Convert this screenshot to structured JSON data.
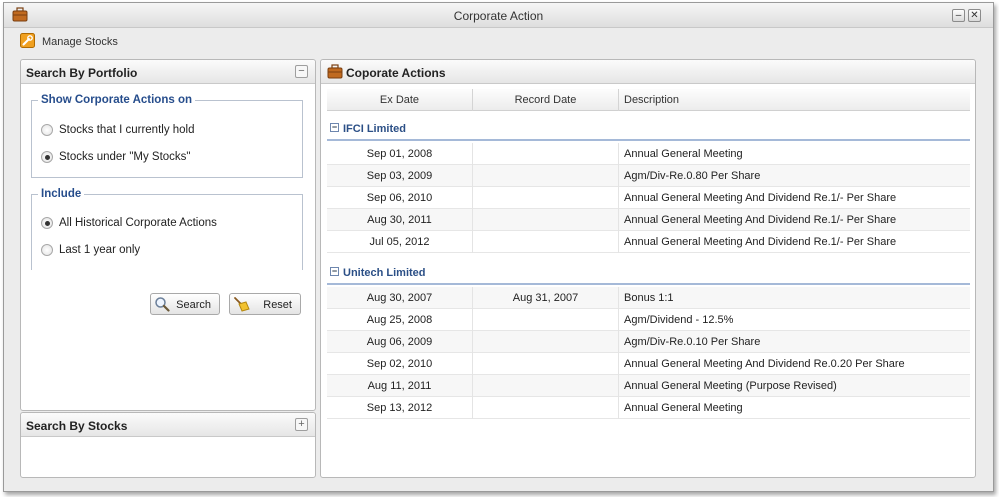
{
  "window": {
    "title": "Corporate Action",
    "minimize_label": "–",
    "close_label": "✕"
  },
  "toolbar": {
    "manage_label": "Manage Stocks"
  },
  "portfolio_panel": {
    "title": "Search By Portfolio",
    "collapse_label": "−",
    "show_group": {
      "legend": "Show Corporate Actions on",
      "options": [
        {
          "label": "Stocks that I currently hold",
          "selected": false
        },
        {
          "label": "Stocks under \"My Stocks\"",
          "selected": true
        }
      ]
    },
    "include_group": {
      "legend": "Include",
      "options": [
        {
          "label": "All Historical Corporate Actions",
          "selected": true
        },
        {
          "label": "Last 1 year only",
          "selected": false
        }
      ]
    },
    "search_button": "Search",
    "reset_button": "Reset"
  },
  "stocks_panel": {
    "title": "Search By Stocks",
    "expand_label": "+"
  },
  "actions_panel": {
    "title": "Coporate Actions",
    "columns": [
      "Ex Date",
      "Record Date",
      "Description"
    ],
    "groups": [
      {
        "name": "IFCI Limited",
        "expand_label": "−",
        "rows": [
          {
            "ex_date": "Sep 01, 2008",
            "record_date": "",
            "description": "Annual General Meeting"
          },
          {
            "ex_date": "Sep 03, 2009",
            "record_date": "",
            "description": "Agm/Div-Re.0.80 Per Share"
          },
          {
            "ex_date": "Sep 06, 2010",
            "record_date": "",
            "description": "Annual General Meeting And Dividend Re.1/- Per Share"
          },
          {
            "ex_date": "Aug 30, 2011",
            "record_date": "",
            "description": "Annual General Meeting And Dividend Re.1/- Per Share"
          },
          {
            "ex_date": "Jul 05, 2012",
            "record_date": "",
            "description": "Annual General Meeting And Dividend Re.1/- Per Share"
          }
        ]
      },
      {
        "name": "Unitech Limited",
        "expand_label": "−",
        "rows": [
          {
            "ex_date": "Aug 30, 2007",
            "record_date": "Aug 31, 2007",
            "description": "Bonus 1:1"
          },
          {
            "ex_date": "Aug 25, 2008",
            "record_date": "",
            "description": "Agm/Dividend - 12.5%"
          },
          {
            "ex_date": "Aug 06, 2009",
            "record_date": "",
            "description": "Agm/Div-Re.0.10 Per Share"
          },
          {
            "ex_date": "Sep 02, 2010",
            "record_date": "",
            "description": "Annual General Meeting And Dividend Re.0.20 Per Share"
          },
          {
            "ex_date": "Aug 11, 2011",
            "record_date": "",
            "description": "Annual General Meeting (Purpose Revised)"
          },
          {
            "ex_date": "Sep 13, 2012",
            "record_date": "",
            "description": "Annual General Meeting"
          }
        ]
      }
    ]
  },
  "colors": {
    "legend_text": "#264d8c",
    "group_text": "#2b4f86",
    "briefcase": "#b0651e"
  },
  "icons": {
    "app": "briefcase-icon",
    "manage": "wrench-icon",
    "actions": "briefcase-icon",
    "search": "magnifier-icon",
    "reset": "broom-icon"
  }
}
